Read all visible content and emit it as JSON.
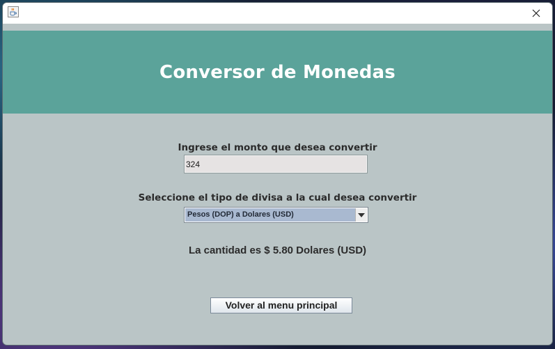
{
  "window": {
    "title": "",
    "icon": "java-cup-icon",
    "close_icon": "close-icon"
  },
  "header": {
    "title": "Conversor de Monedas",
    "band_color": "#5ba39a"
  },
  "form": {
    "amount_label": "Ingrese el monto que desea convertir",
    "amount_value": "324",
    "currency_label": "Seleccione el tipo de divisa a la cual desea convertir",
    "currency_selected": "Pesos (DOP) a Dolares (USD)",
    "currency_dropdown_icon": "chevron-down-icon"
  },
  "result": {
    "text": "La cantidad es $ 5.80 Dolares (USD)"
  },
  "actions": {
    "back_label": "Volver al menu principal"
  },
  "colors": {
    "background": "#bac5c6",
    "accent": "#5ba39a",
    "selection": "#a9b9d0"
  }
}
